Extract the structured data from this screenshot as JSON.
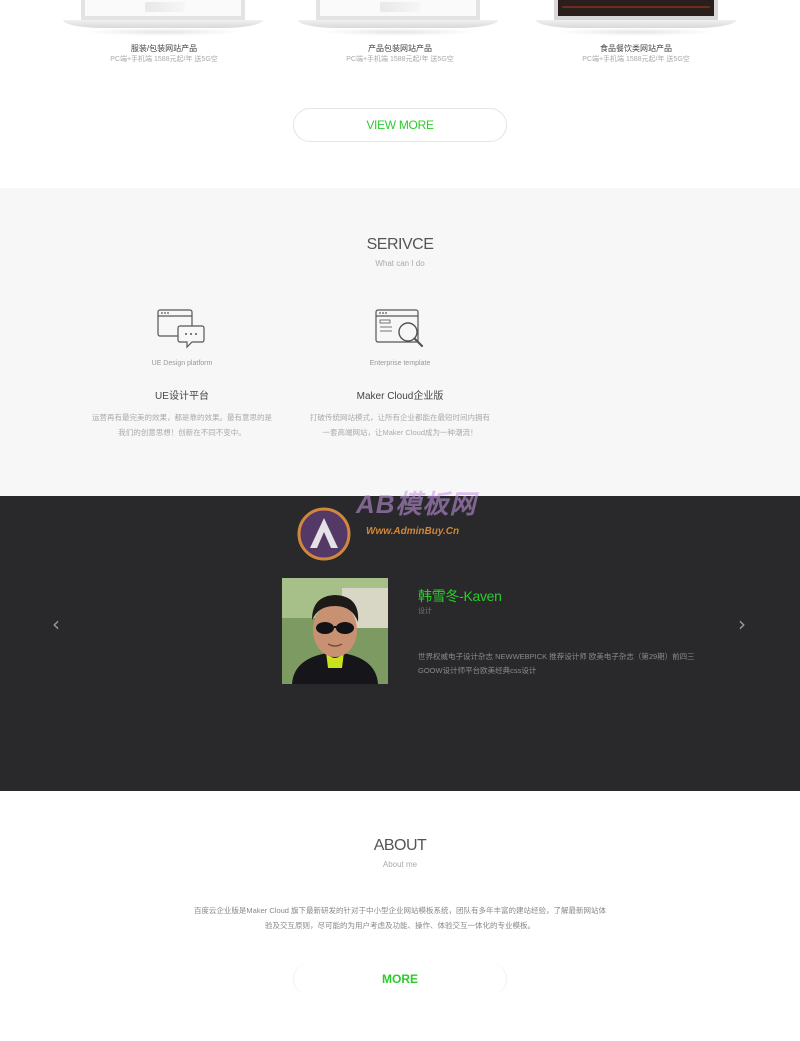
{
  "products": {
    "items": [
      {
        "title": "服装/包装网站产品",
        "subtitle": "PC端+手机端 1588元起/年 送5G空"
      },
      {
        "title": "产品包装网站产品",
        "subtitle": "PC端+手机端 1588元起/年 送5G空"
      },
      {
        "title": "食品餐饮类网站产品",
        "subtitle": "PC端+手机端 1588元起/年 送5G空"
      }
    ],
    "view_more_label": "VIEW MORE"
  },
  "service": {
    "title": "SERIVCE",
    "subtitle": "What can I do",
    "items": [
      {
        "icon": "chat-window-icon",
        "en_label": "UE Design platform",
        "cn_title": "UE设计平台",
        "desc_line1": "运营再有最完美的效果，都是靠的效果。最有意思的是",
        "desc_line2": "我们的创意思想！创新在不同不变中。"
      },
      {
        "icon": "search-window-icon",
        "en_label": "Enterprise template",
        "cn_title": "Maker Cloud企业版",
        "desc_line1": "打破传统网站模式，让所有企业都能在最短时间内拥有",
        "desc_line2": "一套高端网站，让Maker Cloud成为一种潮流！"
      }
    ]
  },
  "team": {
    "name": "韩雪冬-Kaven",
    "role": "设计",
    "desc_line1": "世界权威电子设计杂志 NEWWEBPICK 推荐设计师 欧美电子杂志（第29期）前四三",
    "desc_line2": "GOOW设计师平台欧美经典css设计",
    "prev_icon": "chevron-left-icon",
    "next_icon": "chevron-right-icon",
    "prev_glyph": "‹",
    "next_glyph": "›",
    "watermark_logo": "AB模板网",
    "watermark_url": "Www.AdminBuy.Cn"
  },
  "about": {
    "title": "ABOUT",
    "subtitle": "About me",
    "desc_line1": "百度云企业版是Maker Cloud 旗下最新研发的针对于中小型企业网站模板系统，团队有多年丰富的建站经验，了解最新网站体",
    "desc_line2": "验及交互原则，尽可能的为用户考虑及功能、操作、体验交互一体化的专业模板。",
    "more_label": "MORE"
  },
  "colors": {
    "accent": "#2ccc2c",
    "dark_bg": "#29292b",
    "light_bg": "#f7f7f7"
  }
}
